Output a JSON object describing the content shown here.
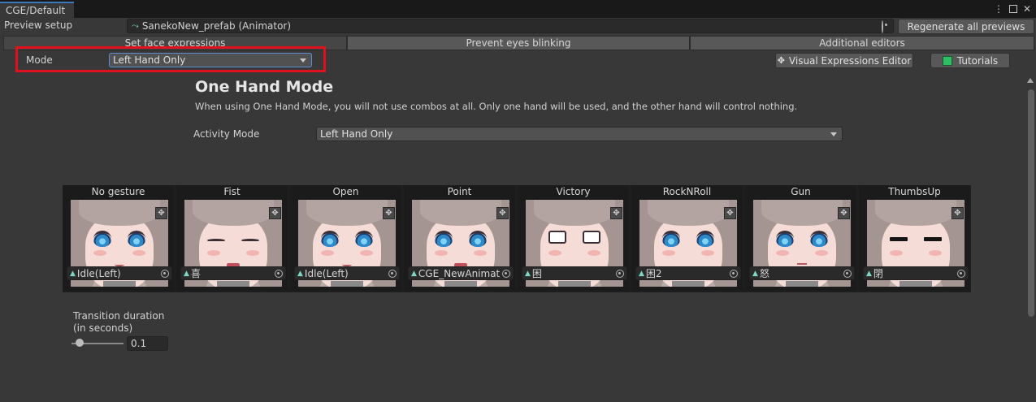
{
  "window": {
    "tab_title": "CGE/Default"
  },
  "preview_setup": {
    "label": "Preview setup",
    "object_icon": "animator-icon",
    "value": "SanekoNew_prefab (Animator)",
    "regenerate_label": "Regenerate all previews"
  },
  "tabs": [
    {
      "label": "Set face expressions",
      "active": true
    },
    {
      "label": "Prevent eyes blinking",
      "active": false
    },
    {
      "label": "Additional editors",
      "active": false
    }
  ],
  "mode": {
    "label": "Mode",
    "value": "Left Hand Only",
    "highlight_color": "#e0101c"
  },
  "buttons": {
    "visual_expressions_editor": "Visual Expressions Editor",
    "tutorials": "Tutorials"
  },
  "one_hand_mode": {
    "title": "One Hand Mode",
    "description": "When using One Hand Mode, you will not use combos at all. Only one hand will be used, and the other hand will control nothing.",
    "activity_label": "Activity Mode",
    "activity_value": "Left Hand Only"
  },
  "gestures": [
    {
      "name": "No gesture",
      "clip": "Idle(Left)"
    },
    {
      "name": "Fist",
      "clip": "喜"
    },
    {
      "name": "Open",
      "clip": "Idle(Left)"
    },
    {
      "name": "Point",
      "clip": "CGE_NewAnimatic"
    },
    {
      "name": "Victory",
      "clip": "困"
    },
    {
      "name": "RockNRoll",
      "clip": "困2"
    },
    {
      "name": "Gun",
      "clip": "怒"
    },
    {
      "name": "ThumbsUp",
      "clip": "閉"
    }
  ],
  "transition": {
    "label_line1": "Transition duration",
    "label_line2": "(in seconds)",
    "value": "0.1",
    "slider_fraction": 0.1
  },
  "colors": {
    "accent": "#3a79bb",
    "background": "#383838"
  }
}
